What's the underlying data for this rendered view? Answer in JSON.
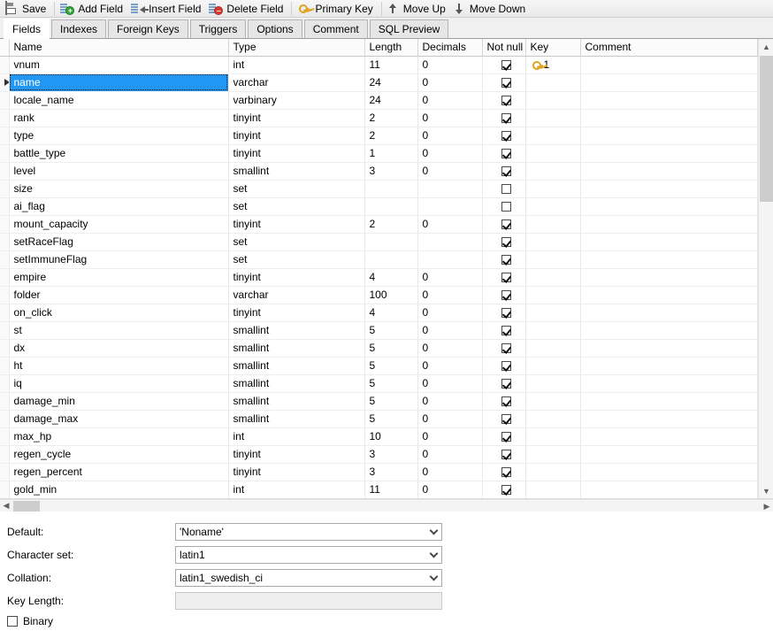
{
  "toolbar": {
    "buttons": [
      {
        "label": "Save",
        "icon": "save-icon"
      },
      {
        "label": "Add Field",
        "icon": "add-field-icon"
      },
      {
        "label": "Insert Field",
        "icon": "insert-field-icon"
      },
      {
        "label": "Delete Field",
        "icon": "delete-field-icon"
      },
      {
        "label": "Primary Key",
        "icon": "key-icon"
      },
      {
        "label": "Move Up",
        "icon": "arrow-up-icon"
      },
      {
        "label": "Move Down",
        "icon": "arrow-down-icon"
      }
    ]
  },
  "tabs": [
    {
      "label": "Fields",
      "active": true
    },
    {
      "label": "Indexes",
      "active": false
    },
    {
      "label": "Foreign Keys",
      "active": false
    },
    {
      "label": "Triggers",
      "active": false
    },
    {
      "label": "Options",
      "active": false
    },
    {
      "label": "Comment",
      "active": false
    },
    {
      "label": "SQL Preview",
      "active": false
    }
  ],
  "grid": {
    "columns": [
      "Name",
      "Type",
      "Length",
      "Decimals",
      "Not null",
      "Key",
      "Comment"
    ],
    "rows": [
      {
        "name": "vnum",
        "type": "int",
        "length": "11",
        "decimals": "0",
        "notnull": true,
        "key": "1",
        "comment": "",
        "selected": false
      },
      {
        "name": "name",
        "type": "varchar",
        "length": "24",
        "decimals": "0",
        "notnull": true,
        "key": "",
        "comment": "",
        "selected": true
      },
      {
        "name": "locale_name",
        "type": "varbinary",
        "length": "24",
        "decimals": "0",
        "notnull": true,
        "key": "",
        "comment": "",
        "selected": false
      },
      {
        "name": "rank",
        "type": "tinyint",
        "length": "2",
        "decimals": "0",
        "notnull": true,
        "key": "",
        "comment": "",
        "selected": false
      },
      {
        "name": "type",
        "type": "tinyint",
        "length": "2",
        "decimals": "0",
        "notnull": true,
        "key": "",
        "comment": "",
        "selected": false
      },
      {
        "name": "battle_type",
        "type": "tinyint",
        "length": "1",
        "decimals": "0",
        "notnull": true,
        "key": "",
        "comment": "",
        "selected": false
      },
      {
        "name": "level",
        "type": "smallint",
        "length": "3",
        "decimals": "0",
        "notnull": true,
        "key": "",
        "comment": "",
        "selected": false
      },
      {
        "name": "size",
        "type": "set",
        "length": "",
        "decimals": "",
        "notnull": false,
        "key": "",
        "comment": "",
        "selected": false
      },
      {
        "name": "ai_flag",
        "type": "set",
        "length": "",
        "decimals": "",
        "notnull": false,
        "key": "",
        "comment": "",
        "selected": false
      },
      {
        "name": "mount_capacity",
        "type": "tinyint",
        "length": "2",
        "decimals": "0",
        "notnull": true,
        "key": "",
        "comment": "",
        "selected": false
      },
      {
        "name": "setRaceFlag",
        "type": "set",
        "length": "",
        "decimals": "",
        "notnull": true,
        "key": "",
        "comment": "",
        "selected": false
      },
      {
        "name": "setImmuneFlag",
        "type": "set",
        "length": "",
        "decimals": "",
        "notnull": true,
        "key": "",
        "comment": "",
        "selected": false
      },
      {
        "name": "empire",
        "type": "tinyint",
        "length": "4",
        "decimals": "0",
        "notnull": true,
        "key": "",
        "comment": "",
        "selected": false
      },
      {
        "name": "folder",
        "type": "varchar",
        "length": "100",
        "decimals": "0",
        "notnull": true,
        "key": "",
        "comment": "",
        "selected": false
      },
      {
        "name": "on_click",
        "type": "tinyint",
        "length": "4",
        "decimals": "0",
        "notnull": true,
        "key": "",
        "comment": "",
        "selected": false
      },
      {
        "name": "st",
        "type": "smallint",
        "length": "5",
        "decimals": "0",
        "notnull": true,
        "key": "",
        "comment": "",
        "selected": false
      },
      {
        "name": "dx",
        "type": "smallint",
        "length": "5",
        "decimals": "0",
        "notnull": true,
        "key": "",
        "comment": "",
        "selected": false
      },
      {
        "name": "ht",
        "type": "smallint",
        "length": "5",
        "decimals": "0",
        "notnull": true,
        "key": "",
        "comment": "",
        "selected": false
      },
      {
        "name": "iq",
        "type": "smallint",
        "length": "5",
        "decimals": "0",
        "notnull": true,
        "key": "",
        "comment": "",
        "selected": false
      },
      {
        "name": "damage_min",
        "type": "smallint",
        "length": "5",
        "decimals": "0",
        "notnull": true,
        "key": "",
        "comment": "",
        "selected": false
      },
      {
        "name": "damage_max",
        "type": "smallint",
        "length": "5",
        "decimals": "0",
        "notnull": true,
        "key": "",
        "comment": "",
        "selected": false
      },
      {
        "name": "max_hp",
        "type": "int",
        "length": "10",
        "decimals": "0",
        "notnull": true,
        "key": "",
        "comment": "",
        "selected": false
      },
      {
        "name": "regen_cycle",
        "type": "tinyint",
        "length": "3",
        "decimals": "0",
        "notnull": true,
        "key": "",
        "comment": "",
        "selected": false
      },
      {
        "name": "regen_percent",
        "type": "tinyint",
        "length": "3",
        "decimals": "0",
        "notnull": true,
        "key": "",
        "comment": "",
        "selected": false
      },
      {
        "name": "gold_min",
        "type": "int",
        "length": "11",
        "decimals": "0",
        "notnull": true,
        "key": "",
        "comment": "",
        "selected": false
      }
    ]
  },
  "properties": {
    "default_label": "Default:",
    "default_value": "'Noname'",
    "charset_label": "Character set:",
    "charset_value": "latin1",
    "collation_label": "Collation:",
    "collation_value": "latin1_swedish_ci",
    "keylength_label": "Key Length:",
    "keylength_value": "",
    "binary_label": "Binary",
    "binary_checked": false
  },
  "colors": {
    "selection": "#2196f3",
    "key_gold": "#e0a424",
    "toolbar_bg": "#f0f0f0"
  }
}
